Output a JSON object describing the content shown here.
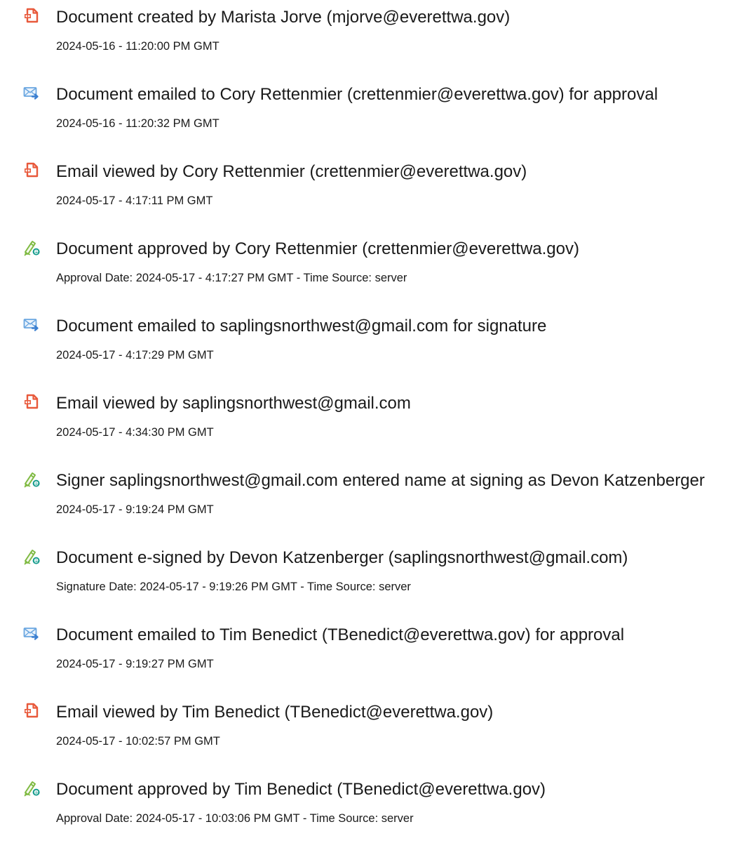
{
  "colors": {
    "document_icon": "#e8593b",
    "email_icon": "#6aa6e0",
    "email_arrow": "#3b7fd0",
    "signature_icon": "#7fba42",
    "signature_badge": "#1a9e8f"
  },
  "events": [
    {
      "icon": "document-icon",
      "title": "Document created by Marista Jorve (mjorve@everettwa.gov)",
      "detail": "2024-05-16 - 11:20:00 PM GMT"
    },
    {
      "icon": "email-sent-icon",
      "title": "Document emailed to Cory Rettenmier (crettenmier@everettwa.gov) for approval",
      "detail": "2024-05-16 - 11:20:32 PM GMT"
    },
    {
      "icon": "document-icon",
      "title": "Email viewed by Cory Rettenmier (crettenmier@everettwa.gov)",
      "detail": "2024-05-17 - 4:17:11 PM GMT"
    },
    {
      "icon": "signature-icon",
      "title": "Document approved by Cory Rettenmier (crettenmier@everettwa.gov)",
      "detail": "Approval Date: 2024-05-17 - 4:17:27 PM GMT - Time Source: server"
    },
    {
      "icon": "email-sent-icon",
      "title": "Document emailed to saplingsnorthwest@gmail.com for signature",
      "detail": "2024-05-17 - 4:17:29 PM GMT"
    },
    {
      "icon": "document-icon",
      "title": "Email viewed by saplingsnorthwest@gmail.com",
      "detail": "2024-05-17 - 4:34:30 PM GMT"
    },
    {
      "icon": "signature-icon",
      "title": "Signer saplingsnorthwest@gmail.com entered name at signing as Devon Katzenberger",
      "detail": "2024-05-17 - 9:19:24 PM GMT"
    },
    {
      "icon": "signature-icon",
      "title": "Document e-signed by Devon Katzenberger (saplingsnorthwest@gmail.com)",
      "detail": "Signature Date: 2024-05-17 - 9:19:26 PM GMT - Time Source: server"
    },
    {
      "icon": "email-sent-icon",
      "title": "Document emailed to Tim Benedict (TBenedict@everettwa.gov) for approval",
      "detail": "2024-05-17 - 9:19:27 PM GMT"
    },
    {
      "icon": "document-icon",
      "title": "Email viewed by Tim Benedict (TBenedict@everettwa.gov)",
      "detail": "2024-05-17 - 10:02:57 PM GMT"
    },
    {
      "icon": "signature-icon",
      "title": "Document approved by Tim Benedict (TBenedict@everettwa.gov)",
      "detail": "Approval Date: 2024-05-17 - 10:03:06 PM GMT - Time Source: server"
    }
  ]
}
